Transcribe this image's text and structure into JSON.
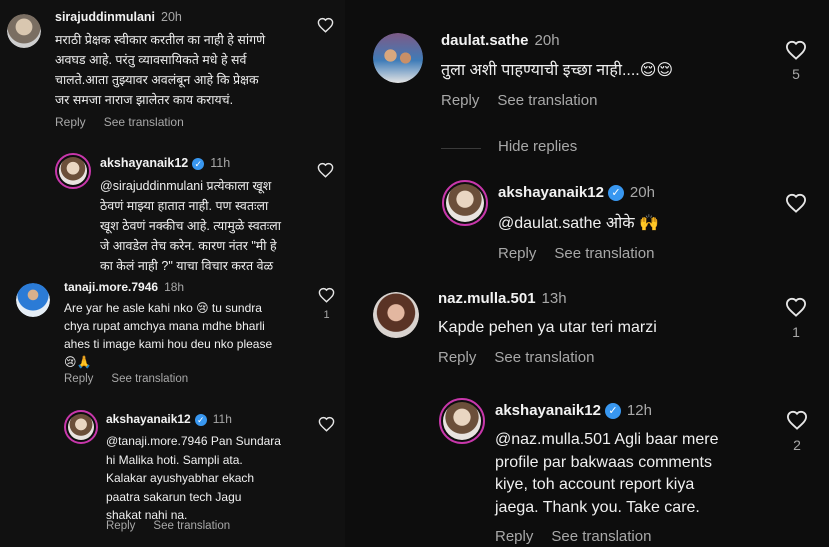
{
  "labels": {
    "reply": "Reply",
    "see_translation": "See translation",
    "hide_replies": "Hide replies"
  },
  "left": {
    "comments": [
      {
        "username": "sirajuddinmulani",
        "time": "20h",
        "text": "मराठी प्रेक्षक स्वीकार करतील का नाही हे सांगणे\nअवघड आहे. परंतु व्यावसायिकते मधे हे सर्व\nचालते.आता तुझ्यावर अवलंबून आहे कि प्रेक्षक\nजर समजा नाराज झालेतर काय करायचं.",
        "likes": ""
      },
      {
        "username": "akshayanaik12",
        "time": "11h",
        "verified": true,
        "text": "@sirajuddinmulani प्रत्येकाला खूश\nठेवणं माझ्या हातात नाही. पण स्वतःला\nखूश ठेवणं नक्कीच आहे. त्यामुळे स्वतःला\nजे आवडेल तेच करेन. कारण नंतर \"मी हे\nका केलं नाही ?\" याचा विचार करत वेळ",
        "likes": ""
      },
      {
        "username": "tanaji.more.7946",
        "time": "18h",
        "text": "Are yar he asle kahi nko 😢 tu sundra\nchya rupat amchya mana mdhe bharli\nahes ti image kami hou deu nko please\n😢🙏",
        "likes": "1"
      },
      {
        "username": "akshayanaik12",
        "time": "11h",
        "verified": true,
        "text": "@tanaji.more.7946 Pan Sundara\nhi Malika hoti. Sampli ata.\nKalakar ayushyabhar ekach\npaatra sakarun tech Jagu\nshakat nahi na.",
        "likes": ""
      }
    ]
  },
  "right": {
    "comments": [
      {
        "username": "daulat.sathe",
        "time": "20h",
        "text": "तुला अशी पाहण्याची इच्छा नाही....😌😌",
        "likes": "5"
      },
      {
        "username": "akshayanaik12",
        "time": "20h",
        "verified": true,
        "text": "@daulat.sathe ओके 🙌",
        "likes": ""
      },
      {
        "username": "naz.mulla.501",
        "time": "13h",
        "text": "Kapde pehen ya utar teri marzi",
        "likes": "1"
      },
      {
        "username": "akshayanaik12",
        "time": "12h",
        "verified": true,
        "text": "@naz.mulla.501 Agli baar mere\nprofile par bakwaas comments\nkiye, toh account report kiya\njaega. Thank you. Take care.",
        "likes": "2"
      }
    ]
  }
}
